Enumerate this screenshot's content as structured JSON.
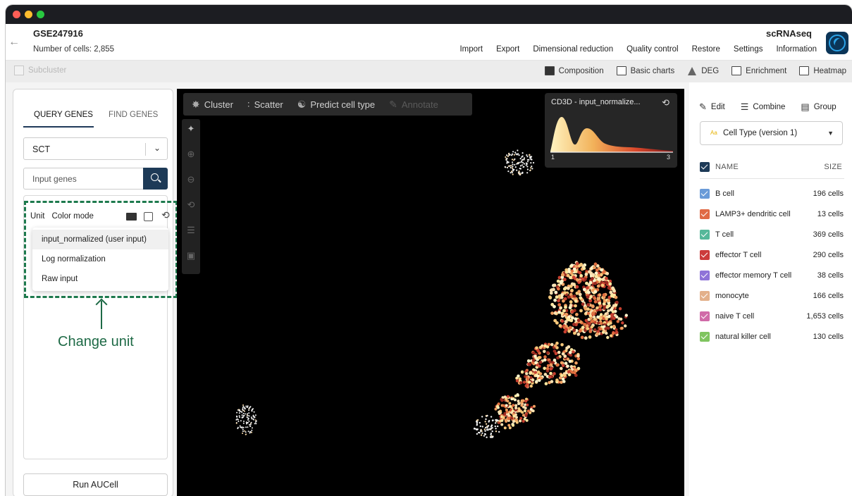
{
  "header": {
    "title": "GSE247916",
    "cell_count": "Number of cells: 2,855",
    "app_name": "scRNAseq",
    "menu": [
      "Import",
      "Export",
      "Dimensional reduction",
      "Quality control",
      "Restore",
      "Settings",
      "Information"
    ]
  },
  "toolbar": {
    "subcluster": "Subcluster",
    "tools": [
      "Composition",
      "Basic charts",
      "DEG",
      "Enrichment",
      "Heatmap"
    ]
  },
  "left": {
    "tabs": [
      "QUERY GENES",
      "FIND GENES"
    ],
    "assay": "SCT",
    "gene_placeholder": "Input genes",
    "unit_label": "Unit",
    "color_mode_label": "Color mode",
    "unit_options": [
      "input_normalized (user input)",
      "Log normalization",
      "Raw input"
    ],
    "annotation": "Change unit",
    "run_button": "Run AUCell"
  },
  "canvas": {
    "tools": [
      "Cluster",
      "Scatter",
      "Predict cell type",
      "Annotate"
    ],
    "histogram": {
      "title": "CD3D - input_normalize...",
      "min": "1",
      "max": "3"
    }
  },
  "right": {
    "actions": [
      "Edit",
      "Combine",
      "Group"
    ],
    "cell_type_select": "Cell Type (version 1)",
    "aa_icon": "Aa",
    "head_name": "NAME",
    "head_size": "SIZE",
    "cell_types": [
      {
        "name": "B cell",
        "size": "196 cells",
        "color": "#6a9bd8"
      },
      {
        "name": "LAMP3+ dendritic cell",
        "size": "13 cells",
        "color": "#e06a45"
      },
      {
        "name": "T cell",
        "size": "369 cells",
        "color": "#55b89a"
      },
      {
        "name": "effector T cell",
        "size": "290 cells",
        "color": "#cc3b3b"
      },
      {
        "name": "effector memory T cell",
        "size": "38 cells",
        "color": "#8f73d8"
      },
      {
        "name": "monocyte",
        "size": "166 cells",
        "color": "#e3b08a"
      },
      {
        "name": "naive T cell",
        "size": "1,653 cells",
        "color": "#d06aa8"
      },
      {
        "name": "natural killer cell",
        "size": "130 cells",
        "color": "#7fc45f"
      }
    ]
  }
}
